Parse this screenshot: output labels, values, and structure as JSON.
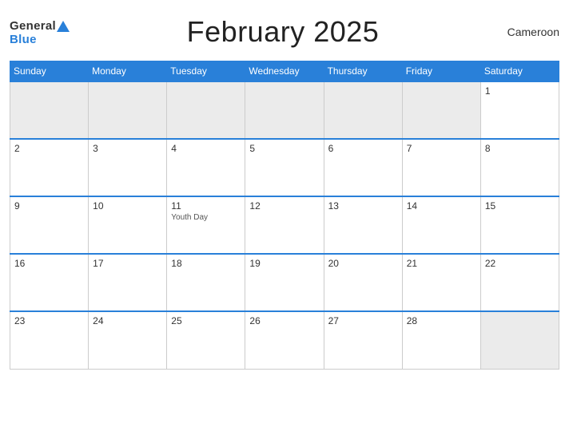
{
  "header": {
    "logo_general": "General",
    "logo_blue": "Blue",
    "title": "February 2025",
    "country": "Cameroon"
  },
  "days_of_week": [
    "Sunday",
    "Monday",
    "Tuesday",
    "Wednesday",
    "Thursday",
    "Friday",
    "Saturday"
  ],
  "weeks": [
    [
      {
        "date": "",
        "empty": true
      },
      {
        "date": "",
        "empty": true
      },
      {
        "date": "",
        "empty": true
      },
      {
        "date": "",
        "empty": true
      },
      {
        "date": "",
        "empty": true
      },
      {
        "date": "",
        "empty": true
      },
      {
        "date": "1",
        "empty": false
      }
    ],
    [
      {
        "date": "2",
        "empty": false
      },
      {
        "date": "3",
        "empty": false
      },
      {
        "date": "4",
        "empty": false
      },
      {
        "date": "5",
        "empty": false
      },
      {
        "date": "6",
        "empty": false
      },
      {
        "date": "7",
        "empty": false
      },
      {
        "date": "8",
        "empty": false
      }
    ],
    [
      {
        "date": "9",
        "empty": false
      },
      {
        "date": "10",
        "empty": false
      },
      {
        "date": "11",
        "empty": false,
        "holiday": "Youth Day"
      },
      {
        "date": "12",
        "empty": false
      },
      {
        "date": "13",
        "empty": false
      },
      {
        "date": "14",
        "empty": false
      },
      {
        "date": "15",
        "empty": false
      }
    ],
    [
      {
        "date": "16",
        "empty": false
      },
      {
        "date": "17",
        "empty": false
      },
      {
        "date": "18",
        "empty": false
      },
      {
        "date": "19",
        "empty": false
      },
      {
        "date": "20",
        "empty": false
      },
      {
        "date": "21",
        "empty": false
      },
      {
        "date": "22",
        "empty": false
      }
    ],
    [
      {
        "date": "23",
        "empty": false
      },
      {
        "date": "24",
        "empty": false
      },
      {
        "date": "25",
        "empty": false
      },
      {
        "date": "26",
        "empty": false
      },
      {
        "date": "27",
        "empty": false
      },
      {
        "date": "28",
        "empty": false
      },
      {
        "date": "",
        "empty": true
      }
    ]
  ]
}
